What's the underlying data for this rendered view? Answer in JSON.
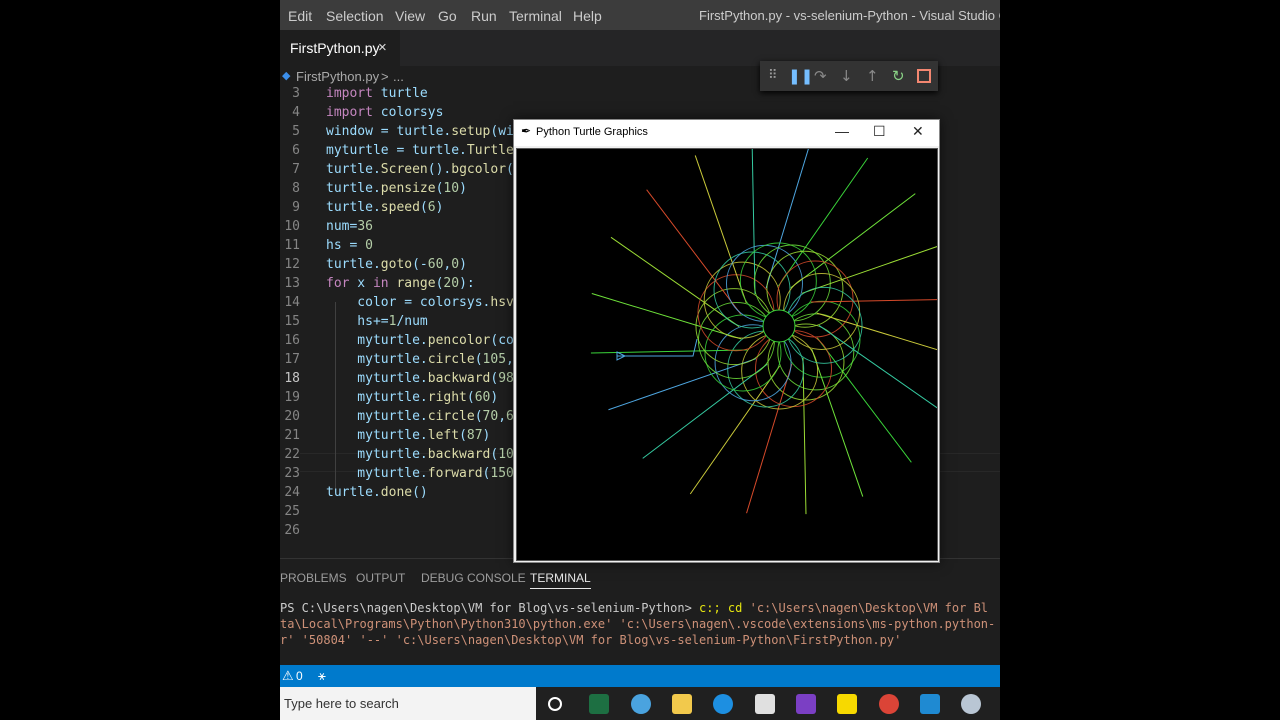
{
  "menu": [
    "Edit",
    "Selection",
    "View",
    "Go",
    "Run",
    "Terminal",
    "Help"
  ],
  "window_title": "FirstPython.py - vs-selenium-Python - Visual Studio Code",
  "tab": {
    "label": "FirstPython.py",
    "close": "×"
  },
  "breadcrumb": {
    "file": "FirstPython.py",
    "sep": ">",
    "more": "..."
  },
  "debug_icons": [
    "drag-icon",
    "pause-icon",
    "step-over-icon",
    "step-into-icon",
    "step-out-icon",
    "restart-icon",
    "stop-icon"
  ],
  "code_lines": [
    {
      "n": "3",
      "text": "import turtle"
    },
    {
      "n": "4",
      "text": "import colorsys"
    },
    {
      "n": "5",
      "text": "window = turtle.setup(wi"
    },
    {
      "n": "6",
      "text": "myturtle = turtle.Turtle"
    },
    {
      "n": "7",
      "text": "turtle.Screen().bgcolor("
    },
    {
      "n": "8",
      "text": "turtle.pensize(10)"
    },
    {
      "n": "9",
      "text": "turtle.speed(6)"
    },
    {
      "n": "10",
      "text": "num=36"
    },
    {
      "n": "11",
      "text": "hs = 0"
    },
    {
      "n": "12",
      "text": "turtle.goto(-60,0)"
    },
    {
      "n": "13",
      "text": "for x in range(20):"
    },
    {
      "n": "14",
      "text": "    color = colorsys.hsv_"
    },
    {
      "n": "15",
      "text": "    hs+=1/num"
    },
    {
      "n": "16",
      "text": "    myturtle.pencolor(co"
    },
    {
      "n": "17",
      "text": "    myturtle.circle(105,"
    },
    {
      "n": "18",
      "text": "    myturtle.backward(98"
    },
    {
      "n": "19",
      "text": "    myturtle.right(60)"
    },
    {
      "n": "20",
      "text": "    myturtle.circle(70,6"
    },
    {
      "n": "21",
      "text": "    myturtle.left(87)"
    },
    {
      "n": "22",
      "text": "    myturtle.backward(10"
    },
    {
      "n": "23",
      "text": "    myturtle.forward(150"
    },
    {
      "n": "24",
      "text": "turtle.done()"
    },
    {
      "n": "25",
      "text": ""
    },
    {
      "n": "26",
      "text": ""
    }
  ],
  "panel_tabs": [
    "PROBLEMS",
    "OUTPUT",
    "DEBUG CONSOLE",
    "TERMINAL"
  ],
  "terminal": {
    "prompt": "PS C:\\Users\\nagen\\Desktop\\VM for Blog\\vs-selenium-Python> ",
    "cmd": "c:; cd ",
    "path1": "'c:\\Users\\nagen\\Desktop\\VM for Bl",
    "line2": "ta\\Local\\Programs\\Python\\Python310\\python.exe' 'c:\\Users\\nagen\\.vscode\\extensions\\ms-python.python-",
    "line3": "r' '50804' '--' 'c:\\Users\\nagen\\Desktop\\VM for Blog\\vs-selenium-Python\\FirstPython.py'"
  },
  "status": {
    "problems": "0"
  },
  "taskbar": {
    "search_placeholder": "Type here to search"
  },
  "turtle_window": {
    "title": "Python Turtle Graphics",
    "minimize": "—",
    "maximize": "☐",
    "close": "✕"
  }
}
